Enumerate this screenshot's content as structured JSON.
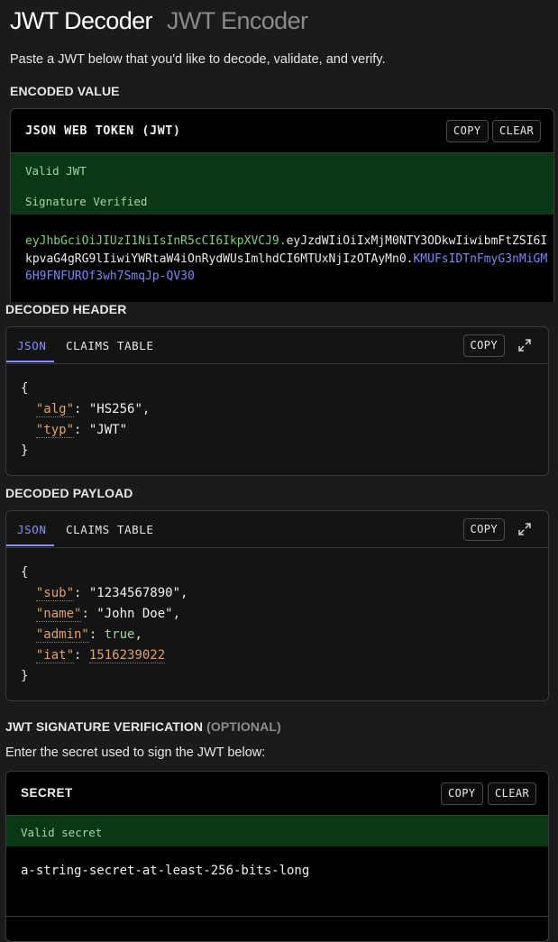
{
  "tabs": {
    "decoder": "JWT Decoder",
    "encoder": "JWT Encoder"
  },
  "intro": "Paste a JWT below that you'd like to decode, validate, and verify.",
  "encoded": {
    "section_label": "ENCODED VALUE",
    "card_title": "JSON WEB TOKEN (JWT)",
    "copy_label": "COPY",
    "clear_label": "CLEAR",
    "status_valid": "Valid JWT",
    "status_signature": "Signature Verified",
    "token_header": "eyJhbGciOiJIUzI1NiIsInR5cCI6IkpXVCJ9.",
    "token_payload": "eyJzdWIiOiIxMjM0NTY3ODkwIiwibmFtZSI6IkpvaG4gRG9lIiwiYWRtaW4iOnRydWUsImlhdCI6MTUxNjIzOTAyMn0.",
    "token_signature": "KMUFsIDTnFmyG3nMiGM6H9FNFUROf3wh7SmqJp-QV30"
  },
  "header": {
    "section_label": "DECODED HEADER",
    "tab_json": "JSON",
    "tab_claims": "CLAIMS TABLE",
    "copy_label": "COPY",
    "open_brace": "{",
    "close_brace": "}",
    "fields": [
      {
        "key": "\"alg\"",
        "value": "\"HS256\""
      },
      {
        "key": "\"typ\"",
        "value": "\"JWT\""
      }
    ]
  },
  "payload": {
    "section_label": "DECODED PAYLOAD",
    "tab_json": "JSON",
    "tab_claims": "CLAIMS TABLE",
    "copy_label": "COPY",
    "open_brace": "{",
    "close_brace": "}",
    "fields": [
      {
        "key": "\"sub\"",
        "value": "\"1234567890\""
      },
      {
        "key": "\"name\"",
        "value": "\"John Doe\""
      },
      {
        "key": "\"admin\"",
        "value": "true"
      },
      {
        "key": "\"iat\"",
        "value": "1516239022"
      }
    ]
  },
  "verification": {
    "section_label": "JWT SIGNATURE VERIFICATION",
    "optional_label": "(OPTIONAL)",
    "instruction": "Enter the secret used to sign the JWT below:",
    "card_title": "SECRET",
    "copy_label": "COPY",
    "clear_label": "CLEAR",
    "status": "Valid secret",
    "secret_value": "a-string-secret-at-least-256-bits-long"
  },
  "colors": {
    "background": "#1b1b1b",
    "accent": "#8a8ff2",
    "valid_green_bg": "#0a3815",
    "token_header": "#7ed07e",
    "token_signature": "#7f86f0",
    "json_key": "#e0a06a"
  }
}
